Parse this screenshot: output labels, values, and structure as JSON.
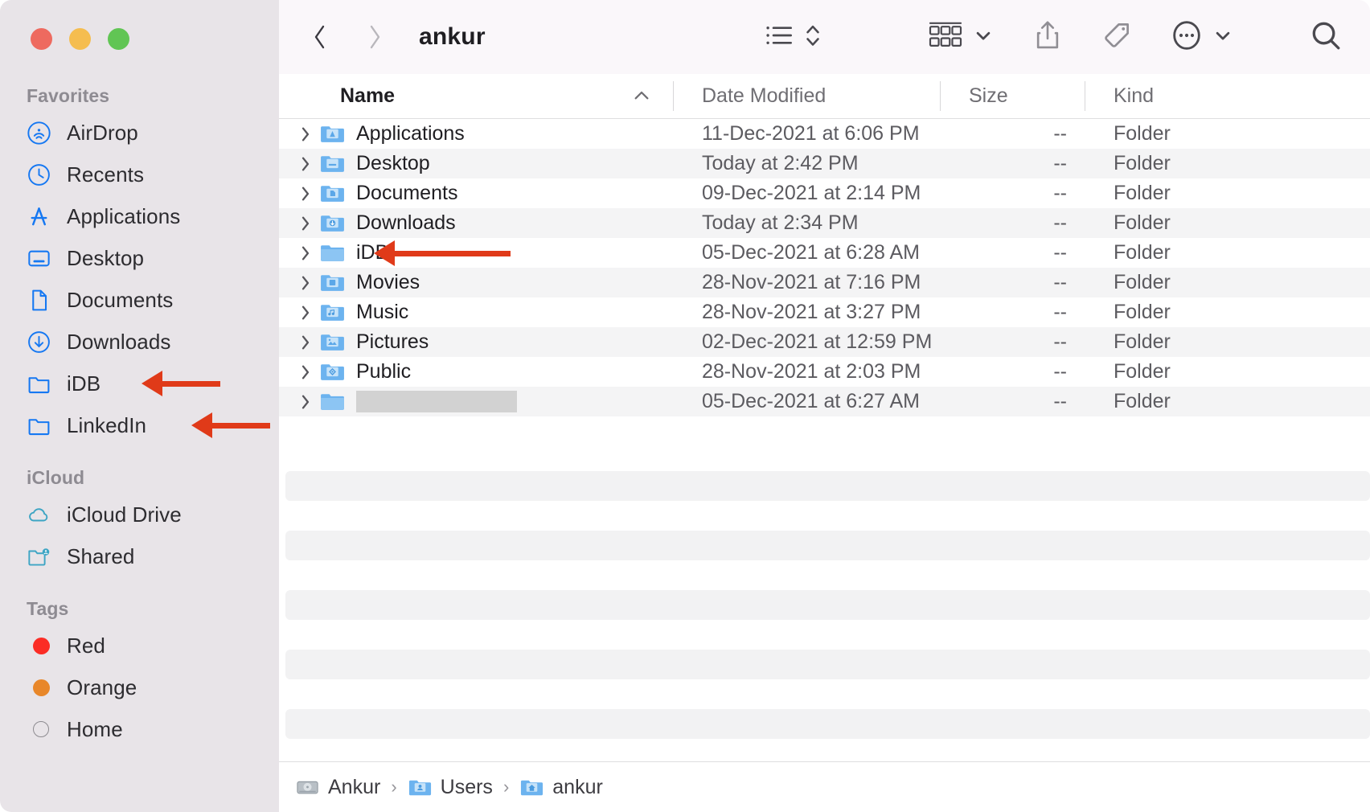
{
  "window": {
    "traffic_lights": [
      {
        "name": "close",
        "color": "#ee6a5f"
      },
      {
        "name": "minimize",
        "color": "#f5bd4f"
      },
      {
        "name": "maximize",
        "color": "#61c554"
      }
    ]
  },
  "sidebar": {
    "groups": [
      {
        "header": "Favorites",
        "items": [
          {
            "label": "AirDrop",
            "icon": "airdrop-icon"
          },
          {
            "label": "Recents",
            "icon": "clock-icon"
          },
          {
            "label": "Applications",
            "icon": "applications-icon"
          },
          {
            "label": "Desktop",
            "icon": "desktop-icon"
          },
          {
            "label": "Documents",
            "icon": "document-icon"
          },
          {
            "label": "Downloads",
            "icon": "downloads-icon"
          },
          {
            "label": "iDB",
            "icon": "folder-icon",
            "annotated": true
          },
          {
            "label": "LinkedIn",
            "icon": "folder-icon",
            "annotated": true
          }
        ]
      },
      {
        "header": "iCloud",
        "items": [
          {
            "label": "iCloud Drive",
            "icon": "cloud-icon"
          },
          {
            "label": "Shared",
            "icon": "shared-folder-icon"
          }
        ]
      },
      {
        "header": "Tags",
        "items": [
          {
            "label": "Red",
            "icon": "tag-dot-icon",
            "color": "#fb2c25"
          },
          {
            "label": "Orange",
            "icon": "tag-dot-icon",
            "color": "#e8872a"
          },
          {
            "label": "Home",
            "icon": "tag-dot-outline-icon",
            "color": "#ffffff"
          }
        ]
      }
    ]
  },
  "toolbar": {
    "back_label": "Back",
    "forward_label": "Forward",
    "title": "ankur",
    "buttons": [
      {
        "name": "list-view-button",
        "icon": "list-view-icon"
      },
      {
        "name": "sort-button",
        "icon": "sort-chevrons-icon"
      },
      {
        "name": "group-by-button",
        "icon": "group-grid-icon"
      },
      {
        "name": "group-by-dropdown",
        "icon": "chevron-down-icon"
      },
      {
        "name": "share-button",
        "icon": "share-icon"
      },
      {
        "name": "tag-button",
        "icon": "tag-icon"
      },
      {
        "name": "more-actions-button",
        "icon": "ellipsis-circle-icon"
      },
      {
        "name": "more-actions-dropdown",
        "icon": "chevron-down-icon"
      },
      {
        "name": "search-button",
        "icon": "search-icon"
      }
    ]
  },
  "columns": {
    "name": "Name",
    "date_modified": "Date Modified",
    "size": "Size",
    "kind": "Kind",
    "sort_direction": "ascending"
  },
  "files": [
    {
      "name": "Applications",
      "icon": "applications-folder-icon",
      "date": "11-Dec-2021 at 6:06 PM",
      "size": "--",
      "kind": "Folder",
      "redacted": false,
      "annotated": false
    },
    {
      "name": "Desktop",
      "icon": "desktop-folder-icon",
      "date": "Today at 2:42 PM",
      "size": "--",
      "kind": "Folder",
      "redacted": false,
      "annotated": false
    },
    {
      "name": "Documents",
      "icon": "documents-folder-icon",
      "date": "09-Dec-2021 at 2:14 PM",
      "size": "--",
      "kind": "Folder",
      "redacted": false,
      "annotated": false
    },
    {
      "name": "Downloads",
      "icon": "downloads-folder-icon",
      "date": "Today at 2:34 PM",
      "size": "--",
      "kind": "Folder",
      "redacted": false,
      "annotated": false
    },
    {
      "name": "iDB",
      "icon": "plain-folder-icon",
      "date": "05-Dec-2021 at 6:28 AM",
      "size": "--",
      "kind": "Folder",
      "redacted": false,
      "annotated": true
    },
    {
      "name": "Movies",
      "icon": "movies-folder-icon",
      "date": "28-Nov-2021 at 7:16 PM",
      "size": "--",
      "kind": "Folder",
      "redacted": false,
      "annotated": false
    },
    {
      "name": "Music",
      "icon": "music-folder-icon",
      "date": "28-Nov-2021 at 3:27 PM",
      "size": "--",
      "kind": "Folder",
      "redacted": false,
      "annotated": false
    },
    {
      "name": "Pictures",
      "icon": "pictures-folder-icon",
      "date": "02-Dec-2021 at 12:59 PM",
      "size": "--",
      "kind": "Folder",
      "redacted": false,
      "annotated": false
    },
    {
      "name": "Public",
      "icon": "public-folder-icon",
      "date": "28-Nov-2021 at 2:03 PM",
      "size": "--",
      "kind": "Folder",
      "redacted": false,
      "annotated": false
    },
    {
      "name": "",
      "icon": "plain-folder-icon",
      "date": "05-Dec-2021 at 6:27 AM",
      "size": "--",
      "kind": "Folder",
      "redacted": true,
      "annotated": false
    }
  ],
  "path_bar": [
    {
      "label": "Ankur",
      "icon": "hard-disk-icon"
    },
    {
      "label": "Users",
      "icon": "users-folder-icon"
    },
    {
      "label": "ankur",
      "icon": "home-folder-icon"
    }
  ],
  "annotation": {
    "color": "#e03a19",
    "type": "arrow-pointing-left"
  }
}
